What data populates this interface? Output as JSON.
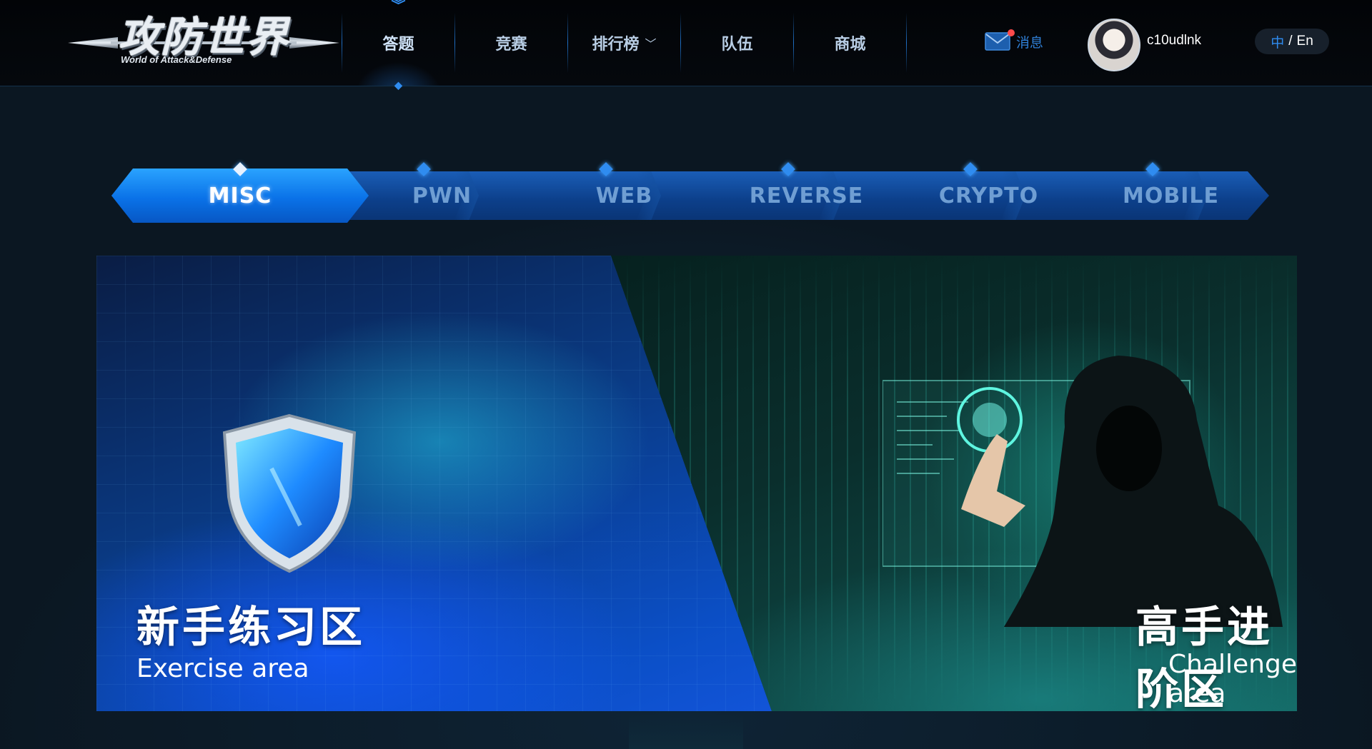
{
  "header": {
    "logo": {
      "title_cn": "攻防世界",
      "title_en": "World of Attack&Defense"
    },
    "nav": [
      {
        "label": "答题",
        "active": true
      },
      {
        "label": "竞赛"
      },
      {
        "label": "排行榜",
        "has_dropdown": true
      },
      {
        "label": "队伍"
      },
      {
        "label": "商城"
      }
    ],
    "messages_label": "消息",
    "messages_icon": "mail-icon",
    "has_unread": true,
    "username": "c10udlnk",
    "language": {
      "cn": "中",
      "separator": "/",
      "en": "En",
      "active": "cn"
    }
  },
  "categories": {
    "tabs": [
      "MISC",
      "PWN",
      "WEB",
      "REVERSE",
      "CRYPTO",
      "MOBILE"
    ],
    "active": "MISC"
  },
  "areas": {
    "exercise": {
      "title_cn": "新手练习区",
      "title_en": "Exercise area"
    },
    "challenge": {
      "title_cn": "高手进阶区",
      "title_en": "Challenge area"
    }
  },
  "colors": {
    "accent": "#2f8cf0",
    "tab_active": "#0a72e8",
    "exercise_bg": "#0b4fc7",
    "challenge_bg": "#0e4a47",
    "unread_dot": "#ff4b4b"
  }
}
